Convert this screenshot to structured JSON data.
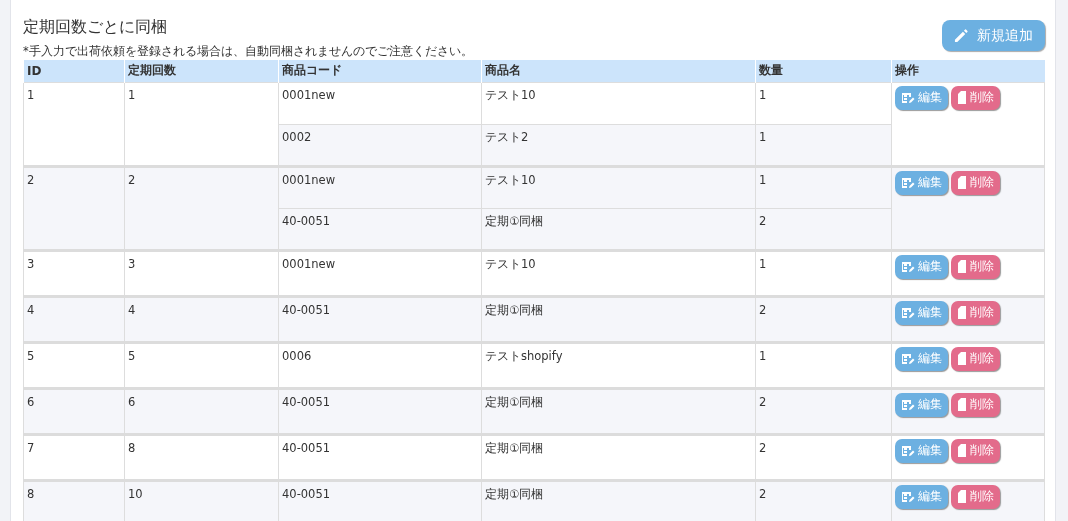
{
  "title": "定期回数ごとに同梱",
  "add_button": "新規追加",
  "note": "*手入力で出荷依頼を登録される場合は、自動同梱されませんのでご注意ください。",
  "table": {
    "columns": [
      "ID",
      "定期回数",
      "商品コード",
      "商品名",
      "数量",
      "操作"
    ],
    "rows": [
      {
        "id": "1",
        "round": "1",
        "items": [
          {
            "code": "0001new",
            "name": "テスト10",
            "qty": "1"
          },
          {
            "code": "0002",
            "name": "テスト2",
            "qty": "1"
          }
        ],
        "actions": [
          "編集",
          "削除"
        ]
      },
      {
        "id": "2",
        "round": "2",
        "items": [
          {
            "code": "0001new",
            "name": "テスト10",
            "qty": "1"
          },
          {
            "code": "40-0051",
            "name": "定期①同梱",
            "qty": "2"
          }
        ],
        "actions": [
          "編集",
          "削除"
        ]
      },
      {
        "id": "3",
        "round": "3",
        "items": [
          {
            "code": "0001new",
            "name": "テスト10",
            "qty": "1"
          }
        ],
        "actions": [
          "編集",
          "削除"
        ]
      },
      {
        "id": "4",
        "round": "4",
        "items": [
          {
            "code": "40-0051",
            "name": "定期①同梱",
            "qty": "2"
          }
        ],
        "actions": [
          "編集",
          "削除"
        ]
      },
      {
        "id": "5",
        "round": "5",
        "items": [
          {
            "code": "0006",
            "name": "テストshopify",
            "qty": "1"
          }
        ],
        "actions": [
          "編集",
          "削除"
        ]
      },
      {
        "id": "6",
        "round": "6",
        "items": [
          {
            "code": "40-0051",
            "name": "定期①同梱",
            "qty": "2"
          }
        ],
        "actions": [
          "編集",
          "削除"
        ]
      },
      {
        "id": "7",
        "round": "8",
        "items": [
          {
            "code": "40-0051",
            "name": "定期①同梱",
            "qty": "2"
          }
        ],
        "actions": [
          "編集",
          "削除"
        ]
      },
      {
        "id": "8",
        "round": "10",
        "items": [
          {
            "code": "40-0051",
            "name": "定期①同梱",
            "qty": "2"
          }
        ],
        "actions": [
          "編集",
          "削除"
        ]
      }
    ]
  }
}
